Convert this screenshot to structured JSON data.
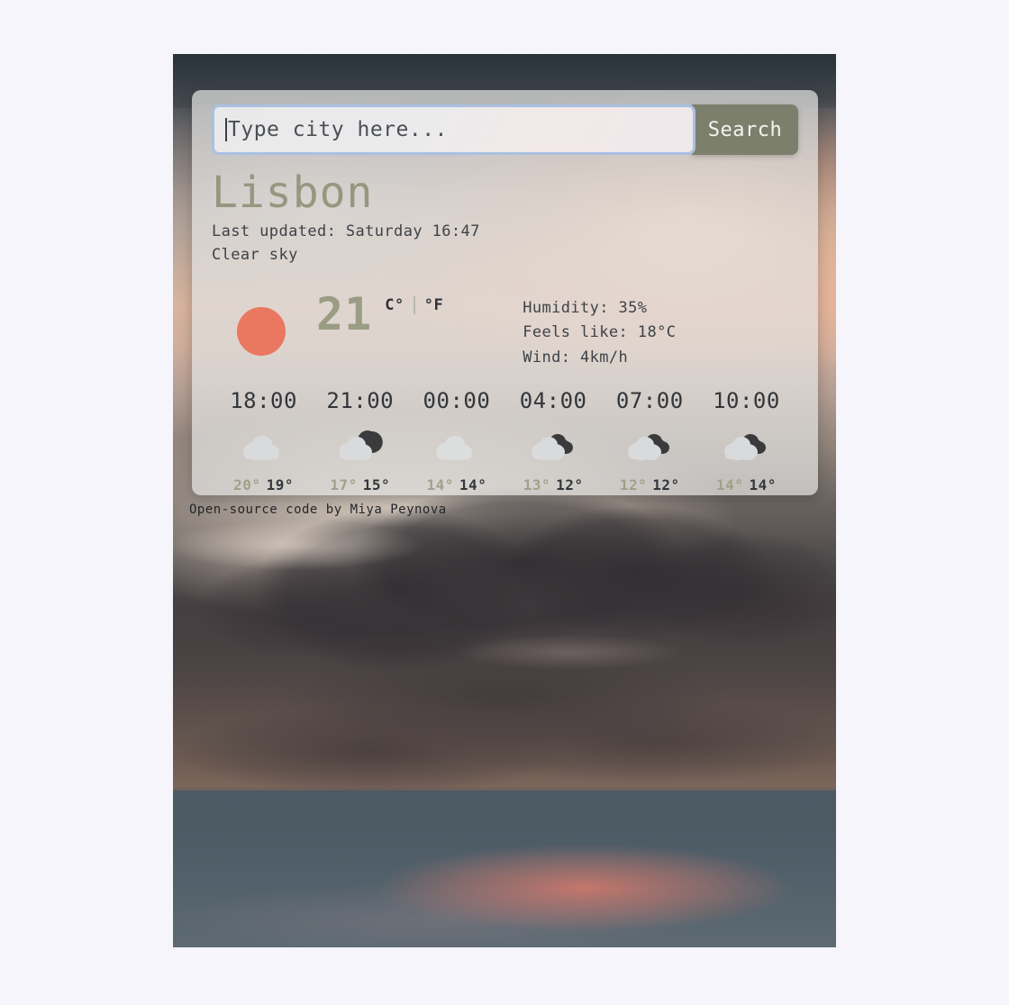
{
  "background": {
    "photo_alt": "sunset-sky-clouds-photo",
    "page_bg": "#f6f5fb"
  },
  "search": {
    "placeholder": "Type city here...",
    "value": "",
    "button_label": "Search"
  },
  "current": {
    "city": "Lisbon",
    "last_updated": "Last updated: Saturday 16:47",
    "description": "Clear sky",
    "icon": "sun-icon",
    "temperature": "21",
    "unit_celsius": "C°",
    "unit_fahrenheit": "°F",
    "humidity": "Humidity: 35%",
    "feels_like": "Feels like: 18°C",
    "wind": "Wind: 4km/h"
  },
  "forecast": [
    {
      "time": "18:00",
      "icon": "cloud-icon",
      "max": "20°",
      "min": "19°"
    },
    {
      "time": "21:00",
      "icon": "cloud-moon-icon",
      "max": "17°",
      "min": "15°"
    },
    {
      "time": "00:00",
      "icon": "cloud-icon",
      "max": "14°",
      "min": "14°"
    },
    {
      "time": "04:00",
      "icon": "clouds-icon",
      "max": "13°",
      "min": "12°"
    },
    {
      "time": "07:00",
      "icon": "clouds-icon",
      "max": "12°",
      "min": "12°"
    },
    {
      "time": "10:00",
      "icon": "clouds-icon",
      "max": "14°",
      "min": "14°"
    }
  ],
  "footer": {
    "credit": "Open-source code by Miya Peynova"
  },
  "colors": {
    "accent_olive": "#96977f",
    "sun_orange": "#ea7860",
    "button_bg": "#7d7f6d",
    "focus_ring": "#a9c0e2"
  }
}
